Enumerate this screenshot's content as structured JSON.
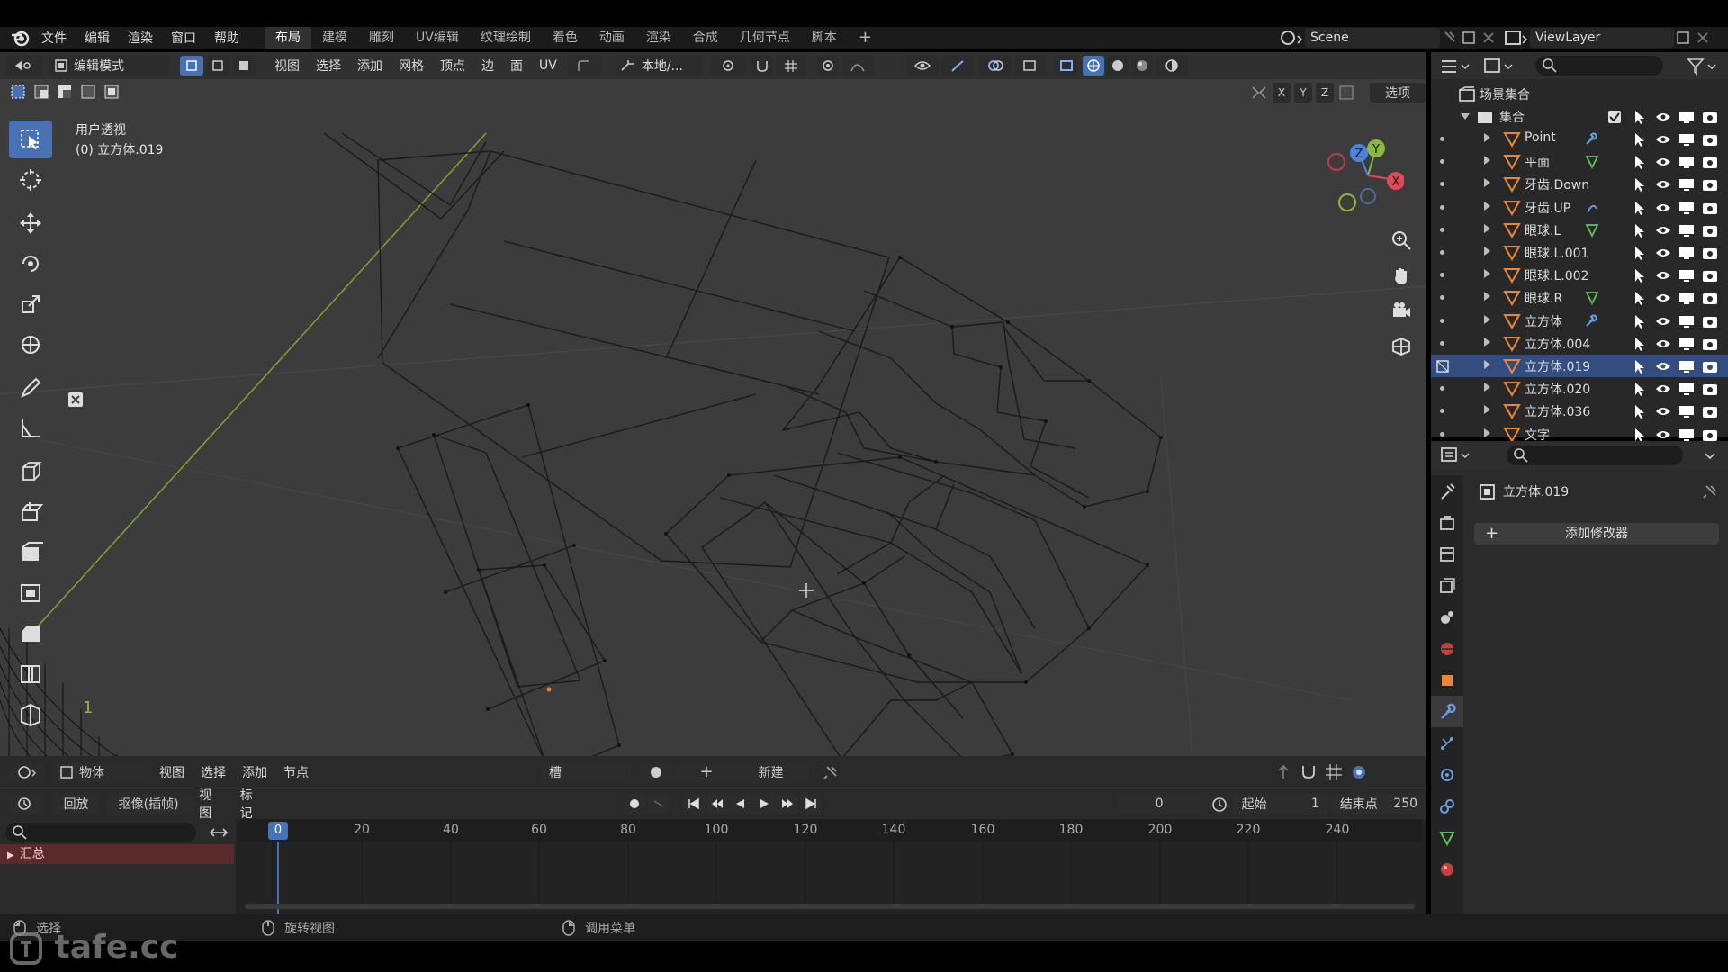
{
  "menu": {
    "items": [
      "文件",
      "编辑",
      "渲染",
      "窗口",
      "帮助"
    ],
    "workspaces": [
      "布局",
      "建模",
      "雕刻",
      "UV编辑",
      "纹理绘制",
      "着色",
      "动画",
      "渲染",
      "合成",
      "几何节点",
      "脚本"
    ],
    "active_workspace": "布局",
    "scene": "Scene",
    "view_layer": "ViewLayer"
  },
  "viewport_header": {
    "mode": "编辑模式",
    "menus": [
      "视图",
      "选择",
      "添加",
      "网格",
      "顶点",
      "边",
      "面",
      "UV"
    ],
    "orientation": "本地/...",
    "axes": [
      "X",
      "Y",
      "Z"
    ],
    "options": "选项"
  },
  "viewport": {
    "view_name": "用户透视",
    "object_label": "(0) 立方体.019",
    "gizmo_axes": [
      "Z",
      "Y",
      "X"
    ],
    "cursor_number": "1"
  },
  "editor_bottom": {
    "mode": "物体",
    "menus": [
      "视图",
      "选择",
      "添加",
      "节点"
    ],
    "slot": "槽",
    "new_label": "新建"
  },
  "timeline": {
    "menus": [
      "回放",
      "抠像(插帧)",
      "视图",
      "标记"
    ],
    "current_frame": "0",
    "start_label": "起始",
    "start": "1",
    "end_label": "结束点",
    "end": "250",
    "ruler": [
      "0",
      "20",
      "40",
      "60",
      "80",
      "100",
      "120",
      "140",
      "160",
      "180",
      "200",
      "220",
      "240"
    ],
    "summary": "汇总"
  },
  "statusbar": {
    "select": "选择",
    "rotate_view": "旋转视图",
    "call_menu": "调用菜单"
  },
  "outliner": {
    "scene_collection": "场景集合",
    "collection": "集合",
    "objects": [
      {
        "name": "Point",
        "extra": "wrench"
      },
      {
        "name": "平面",
        "extra": "vertex"
      },
      {
        "name": "牙齿.Down",
        "extra": ""
      },
      {
        "name": "牙齿.UP",
        "extra": "curve"
      },
      {
        "name": "眼球.L",
        "extra": "vertex"
      },
      {
        "name": "眼球.L.001",
        "extra": ""
      },
      {
        "name": "眼球.L.002",
        "extra": ""
      },
      {
        "name": "眼球.R",
        "extra": "vertex"
      },
      {
        "name": "立方体",
        "extra": "wrench"
      },
      {
        "name": "立方体.004",
        "extra": ""
      },
      {
        "name": "立方体.019",
        "extra": "",
        "selected": true
      },
      {
        "name": "立方体.020",
        "extra": ""
      },
      {
        "name": "立方体.036",
        "extra": ""
      },
      {
        "name": "文字",
        "extra": ""
      }
    ]
  },
  "properties": {
    "object_name": "立方体.019",
    "add_modifier": "添加修改器"
  },
  "watermark": "tafe.cc",
  "colors": {
    "accent": "#4772b3",
    "viewport_bg": "#3c3c3c",
    "selected_row": "#334d80",
    "mesh_orange": "#e8873a"
  }
}
